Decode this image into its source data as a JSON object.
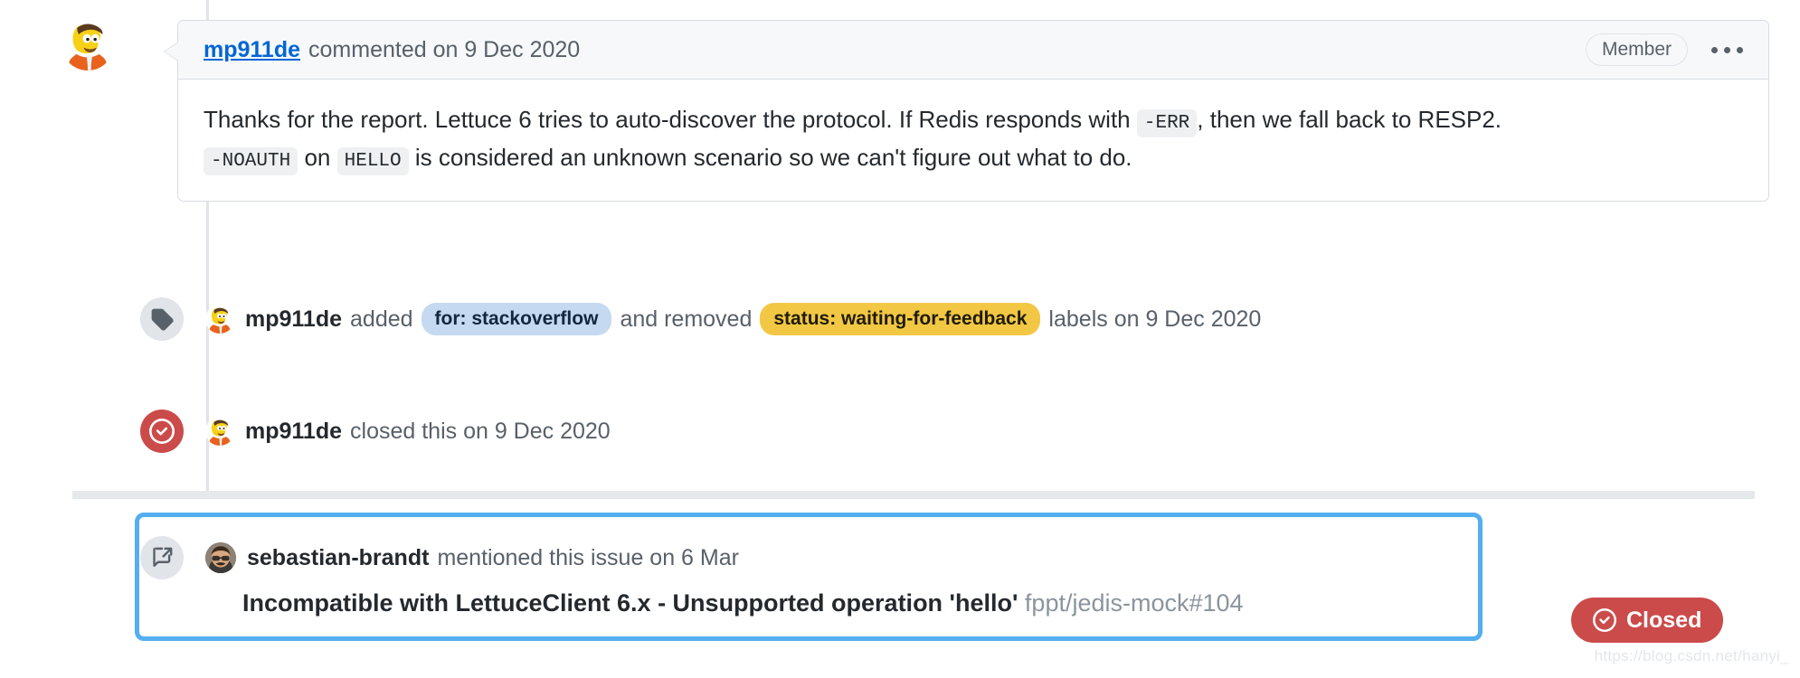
{
  "colors": {
    "link": "#0366d6",
    "muted": "#586069",
    "text": "#24292e",
    "label_blue_bg": "#c5d9f0",
    "label_blue_text": "#11283f",
    "label_yellow_bg": "#f2c744",
    "label_yellow_text": "#1f1b06",
    "closed_red": "#cb4b4b",
    "highlight_border": "#54aeef",
    "code_bg": "#eef0f2"
  },
  "comment": {
    "author": "mp911de",
    "meta": "commented on 9 Dec 2020",
    "badge": "Member",
    "menu_icon": "kebab-horizontal-icon",
    "body": {
      "line1_part1": "Thanks for the report. Lettuce 6 tries to auto-discover the protocol. If Redis responds with",
      "code1": "-ERR",
      "line1_part2": ", then we fall back to RESP2.",
      "code2": "-NOAUTH",
      "line2_part1": "on",
      "code3": "HELLO",
      "line2_part2": "is considered an unknown scenario so we can't figure out what to do."
    }
  },
  "events": [
    {
      "id": "label-event",
      "icon": "tag-icon",
      "actor": "mp911de",
      "verb_added": "added",
      "label_added": "for: stackoverflow",
      "verb_removed": "and removed",
      "label_removed": "status: waiting-for-feedback",
      "suffix": "labels on 9 Dec 2020"
    },
    {
      "id": "closed-event",
      "icon": "issue-closed-icon",
      "actor": "mp911de",
      "text": "closed this on 9 Dec 2020"
    }
  ],
  "mention": {
    "icon": "cross-reference-icon",
    "actor": "sebastian-brandt",
    "text": "mentioned this issue on 6 Mar",
    "issue_title": "Incompatible with LettuceClient 6.x - Unsupported operation 'hello'",
    "repo_ref": "fppt/jedis-mock#104"
  },
  "status": {
    "icon": "issue-closed-icon",
    "label": "Closed"
  },
  "watermark": "https://blog.csdn.net/hanyi_"
}
